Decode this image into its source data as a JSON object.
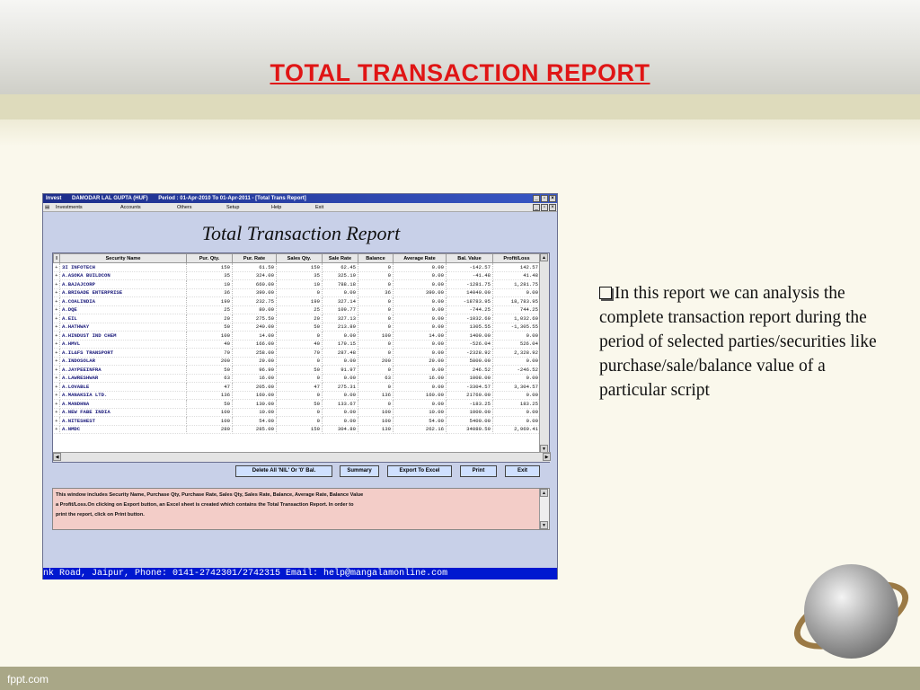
{
  "slide": {
    "title": "TOTAL TRANSACTION REPORT",
    "bullet_text": "In this report we can analysis the complete transaction report during the period of selected parties/securities like purchase/sale/balance value of a particular script",
    "footer_brand": "fppt.com",
    "colors": {
      "title": "#e01515",
      "band": "#dedbbc",
      "footer": "#a9a787"
    }
  },
  "app": {
    "titlebar": {
      "app_name": "Invest",
      "client": "DAMODAR LAL GUPTA (HUF)",
      "period": "Period : 01-Apr-2010 To 01-Apr-2011 - [Total Trans Report]"
    },
    "menu": [
      "Investments",
      "Accounts",
      "Others",
      "Setup",
      "Help",
      "Exit"
    ],
    "report_title": "Total Transaction Report",
    "grid": {
      "columns": [
        "I",
        "Security Name",
        "Pur. Qty.",
        "Pur. Rate",
        "Sales Qty.",
        "Sale Rate",
        "Balance",
        "Average Rate",
        "Bal. Value",
        "Profit/Loss"
      ],
      "rows": [
        [
          "+",
          "3I INFOTECH",
          "150",
          "61.50",
          "150",
          "62.45",
          "0",
          "0.00",
          "-142.57",
          "142.57"
        ],
        [
          "+",
          "A.ASOKA BUILDCON",
          "35",
          "324.00",
          "35",
          "325.19",
          "0",
          "0.00",
          "-41.48",
          "41.48"
        ],
        [
          "+",
          "A.BAJAJCORP",
          "10",
          "660.00",
          "10",
          "788.18",
          "0",
          "0.00",
          "-1281.75",
          "1,281.75"
        ],
        [
          "+",
          "A.BRIGADE ENTERPRISE",
          "36",
          "390.00",
          "0",
          "0.00",
          "36",
          "390.00",
          "14040.00",
          "0.00"
        ],
        [
          "+",
          "A.COALINDIA",
          "199",
          "232.75",
          "199",
          "327.14",
          "0",
          "0.00",
          "-18783.95",
          "18,783.95"
        ],
        [
          "+",
          "A.DQE",
          "25",
          "80.00",
          "25",
          "109.77",
          "0",
          "0.00",
          "-744.25",
          "744.25"
        ],
        [
          "+",
          "A.EIL",
          "20",
          "275.50",
          "20",
          "327.13",
          "0",
          "0.00",
          "-1032.60",
          "1,032.60"
        ],
        [
          "+",
          "A.HATHWAY",
          "50",
          "240.00",
          "50",
          "213.89",
          "0",
          "0.00",
          "1305.55",
          "-1,305.55"
        ],
        [
          "+",
          "A.HINDUST IND CHEM",
          "100",
          "14.00",
          "0",
          "0.00",
          "100",
          "14.00",
          "1400.00",
          "0.00"
        ],
        [
          "+",
          "A.HMVL",
          "40",
          "166.00",
          "40",
          "179.15",
          "0",
          "0.00",
          "-526.04",
          "526.04"
        ],
        [
          "+",
          "A.IL&FS TRANSPORT",
          "79",
          "258.00",
          "79",
          "287.48",
          "0",
          "0.00",
          "-2328.92",
          "2,328.92"
        ],
        [
          "+",
          "A.INDOSOLAR",
          "200",
          "29.00",
          "0",
          "0.00",
          "200",
          "29.00",
          "5800.00",
          "0.00"
        ],
        [
          "+",
          "A.JAYPEEINFRA",
          "50",
          "96.90",
          "50",
          "91.97",
          "0",
          "0.00",
          "246.52",
          "-246.52"
        ],
        [
          "+",
          "A.LAWRESHWAR",
          "63",
          "16.00",
          "0",
          "0.00",
          "63",
          "16.00",
          "1008.00",
          "0.00"
        ],
        [
          "+",
          "A.LOVABLE",
          "47",
          "205.00",
          "47",
          "275.31",
          "0",
          "0.00",
          "-3304.57",
          "3,304.57"
        ],
        [
          "+",
          "A.MANAKSIA LTD.",
          "136",
          "160.00",
          "0",
          "0.00",
          "136",
          "160.00",
          "21760.00",
          "0.00"
        ],
        [
          "+",
          "A.MANDHNA",
          "50",
          "130.00",
          "50",
          "133.67",
          "0",
          "0.00",
          "-183.25",
          "183.25"
        ],
        [
          "+",
          "A.NEW FABE INDIA",
          "100",
          "10.00",
          "0",
          "0.00",
          "100",
          "10.00",
          "1000.00",
          "0.00"
        ],
        [
          "+",
          "A.NITESHEST",
          "100",
          "54.00",
          "0",
          "0.00",
          "100",
          "54.00",
          "5400.00",
          "0.00"
        ],
        [
          "+",
          "A.NMDC",
          "280",
          "285.00",
          "150",
          "304.80",
          "130",
          "262.16",
          "34080.59",
          "2,969.41"
        ]
      ]
    },
    "buttons": {
      "delete_nil": "Delete All 'NIL' Or '0' Bal.",
      "summary": "Summary",
      "export": "Export To Excel",
      "print": "Print",
      "exit": "Exit"
    },
    "help_lines": [
      "This window includes Security Name, Purchase Qty, Purchase Rate, Sales Qty, Sales Rate, Balance, Average Rate, Balance Value",
      "a Profit/Loss.On clicking on Export button, an Excel sheet is created which contains the Total Transaction Report. In order to",
      "print the report, click on Print button."
    ],
    "status_text": "nk Road, Jaipur, Phone: 0141-2742301/2742315 Email: help@mangalamonline.com"
  }
}
